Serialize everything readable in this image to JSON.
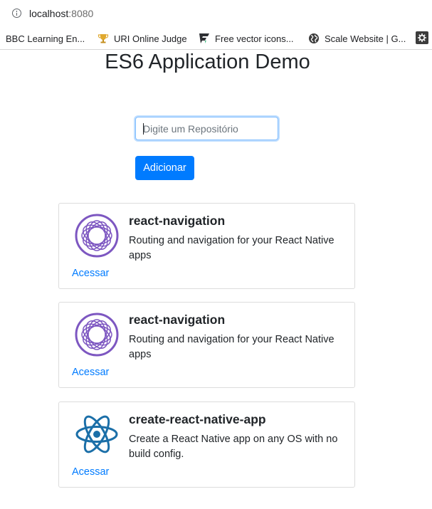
{
  "browser": {
    "url_host": "localhost",
    "url_port": ":8080",
    "bookmarks": [
      {
        "label": "BBC Learning En...",
        "icon": "bbc-icon"
      },
      {
        "label": "URI Online Judge",
        "icon": "trophy-icon"
      },
      {
        "label": "Free vector icons...",
        "icon": "flaticon-icon"
      },
      {
        "label": "Scale Website | G...",
        "icon": "globe-icon"
      }
    ]
  },
  "page": {
    "title": "ES6 Application Demo",
    "input_placeholder": "Digite um Repositório",
    "add_button": "Adicionar"
  },
  "repos": [
    {
      "name": "react-navigation",
      "description": "Routing and navigation for your React Native apps",
      "link": "Acessar",
      "logo": "react-navigation-icon"
    },
    {
      "name": "react-navigation",
      "description": "Routing and navigation for your React Native apps",
      "link": "Acessar",
      "logo": "react-navigation-icon"
    },
    {
      "name": "create-react-native-app",
      "description": "Create a React Native app on any OS with no build config.",
      "link": "Acessar",
      "logo": "react-atom-icon"
    }
  ],
  "colors": {
    "primary": "#007bff",
    "nav_purple": "#7d57c1",
    "react_blue": "#1b6fa8"
  }
}
